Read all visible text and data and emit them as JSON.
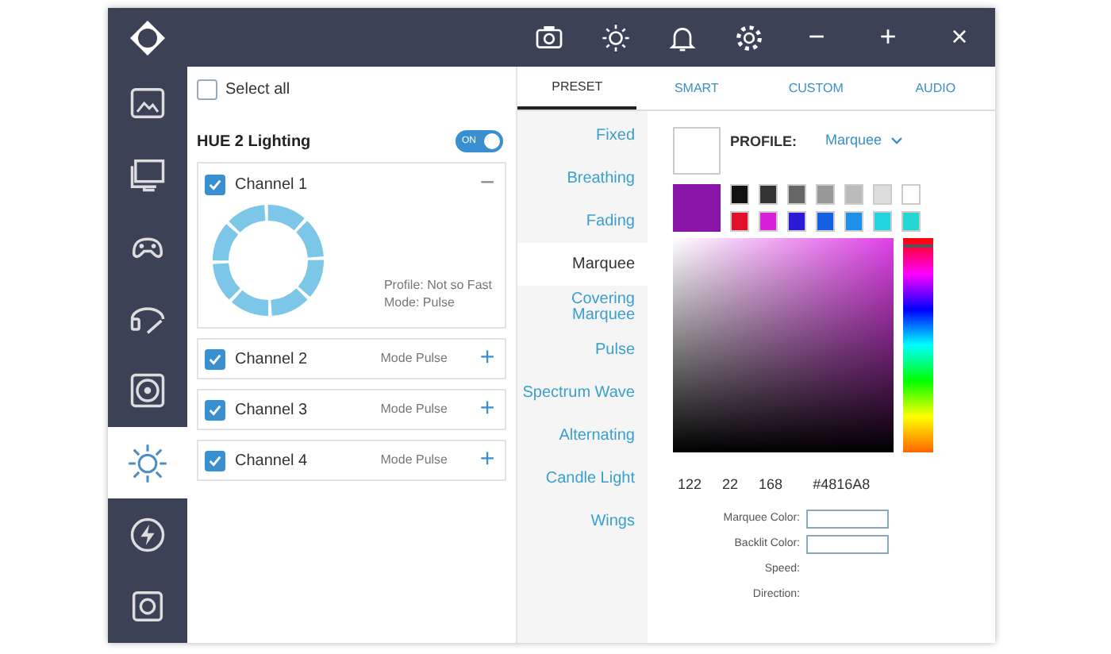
{
  "sidebar": {
    "items": [
      {
        "kind": "image",
        "selected": false
      },
      {
        "kind": "monitor",
        "selected": false
      },
      {
        "kind": "gamepad",
        "selected": false
      },
      {
        "kind": "headset",
        "selected": false
      },
      {
        "kind": "fan",
        "selected": false
      },
      {
        "kind": "sun",
        "selected": true
      },
      {
        "kind": "bolt",
        "selected": false
      },
      {
        "kind": "device",
        "selected": false
      }
    ]
  },
  "toolbar": {
    "window_buttons": [
      "−",
      "+",
      "×"
    ]
  },
  "select_all": {
    "label": "Select all",
    "checked": false
  },
  "device": {
    "name": "HUE 2 Lighting",
    "toggle": {
      "label": "ON",
      "on": true
    }
  },
  "channels": [
    {
      "name": "Channel 1",
      "checked": true,
      "expanded": true,
      "profile_label": "Profile:",
      "profile": "Not so Fast",
      "mode_label": "Mode:",
      "mode": "Pulse",
      "toggle_icon": "−"
    },
    {
      "name": "Channel 2",
      "checked": true,
      "expanded": false,
      "mode_label": "Mode",
      "mode": "Pulse",
      "toggle_icon": "+"
    },
    {
      "name": "Channel 3",
      "checked": true,
      "expanded": false,
      "mode_label": "Mode",
      "mode": "Pulse",
      "toggle_icon": "+"
    },
    {
      "name": "Channel 4",
      "checked": true,
      "expanded": false,
      "mode_label": "Mode",
      "mode": "Pulse",
      "toggle_icon": "+"
    }
  ],
  "tabs": [
    {
      "label": "PRESET",
      "selected": true
    },
    {
      "label": "SMART",
      "selected": false
    },
    {
      "label": "CUSTOM",
      "selected": false
    },
    {
      "label": "AUDIO",
      "selected": false
    }
  ],
  "presets": [
    {
      "label": "Fixed",
      "selected": false
    },
    {
      "label": "Breathing",
      "selected": false
    },
    {
      "label": "Fading",
      "selected": false
    },
    {
      "label": "Marquee",
      "selected": true
    },
    {
      "label": "Covering Marquee",
      "selected": false
    },
    {
      "label": "Pulse",
      "selected": false
    },
    {
      "label": "Spectrum Wave",
      "selected": false
    },
    {
      "label": "Alternating",
      "selected": false
    },
    {
      "label": "Candle Light",
      "selected": false
    },
    {
      "label": "Wings",
      "selected": false
    }
  ],
  "profile": {
    "label": "PROFILE:",
    "value": "Marquee"
  },
  "hue_slider": {
    "level": 0.97
  },
  "swatches": [
    {
      "color": "#111111"
    },
    {
      "color": "#333333"
    },
    {
      "color": "#666666"
    },
    {
      "color": "#999999"
    },
    {
      "color": "#bbbbbb"
    },
    {
      "color": "#dddddd"
    },
    {
      "color": "#ffffff"
    },
    {
      "color": "#e0112b"
    },
    {
      "color": "#d61fd6"
    },
    {
      "color": "#2a1ad6"
    },
    {
      "color": "#1560e0"
    },
    {
      "color": "#1e90e8"
    },
    {
      "color": "#22d4e0"
    },
    {
      "color": "#22d8d0"
    }
  ],
  "picker": {
    "values": [
      "122",
      "22",
      "168",
      "#4816A8"
    ]
  },
  "settings": [
    {
      "label": "Marquee Color:",
      "kind": "field"
    },
    {
      "label": "Backlit Color:",
      "kind": "field"
    },
    {
      "label": "Speed:",
      "kind": "label"
    },
    {
      "label": "Direction:",
      "kind": "label"
    }
  ]
}
